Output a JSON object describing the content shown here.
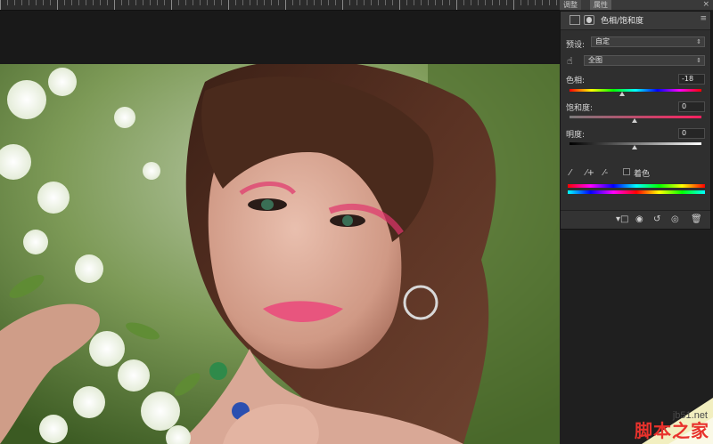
{
  "panel_tabs": {
    "tab1": "调整",
    "tab2": "属性",
    "close": "×"
  },
  "panel": {
    "title": "色相/饱和度",
    "menu_icon": "≡",
    "preset_label": "预设:",
    "preset_value": "自定",
    "channel_value": "全图",
    "hue_label": "色相:",
    "hue_value": "-18",
    "saturation_label": "饱和度:",
    "saturation_value": "0",
    "lightness_label": "明度:",
    "lightness_value": "0",
    "colorize_label": "着色"
  },
  "watermark": {
    "site": "jb51.net",
    "brand": "脚本之家"
  },
  "colors": {
    "panel_bg": "#2f2f2f",
    "accent_red": "#e8322c"
  },
  "icons": [
    "layer-mask-icon",
    "hand-target-icon",
    "eyedropper-icon",
    "eyedropper-plus-icon",
    "eyedropper-minus-icon",
    "clip-icon",
    "view-previous-icon",
    "reset-icon",
    "visibility-icon",
    "trash-icon"
  ]
}
